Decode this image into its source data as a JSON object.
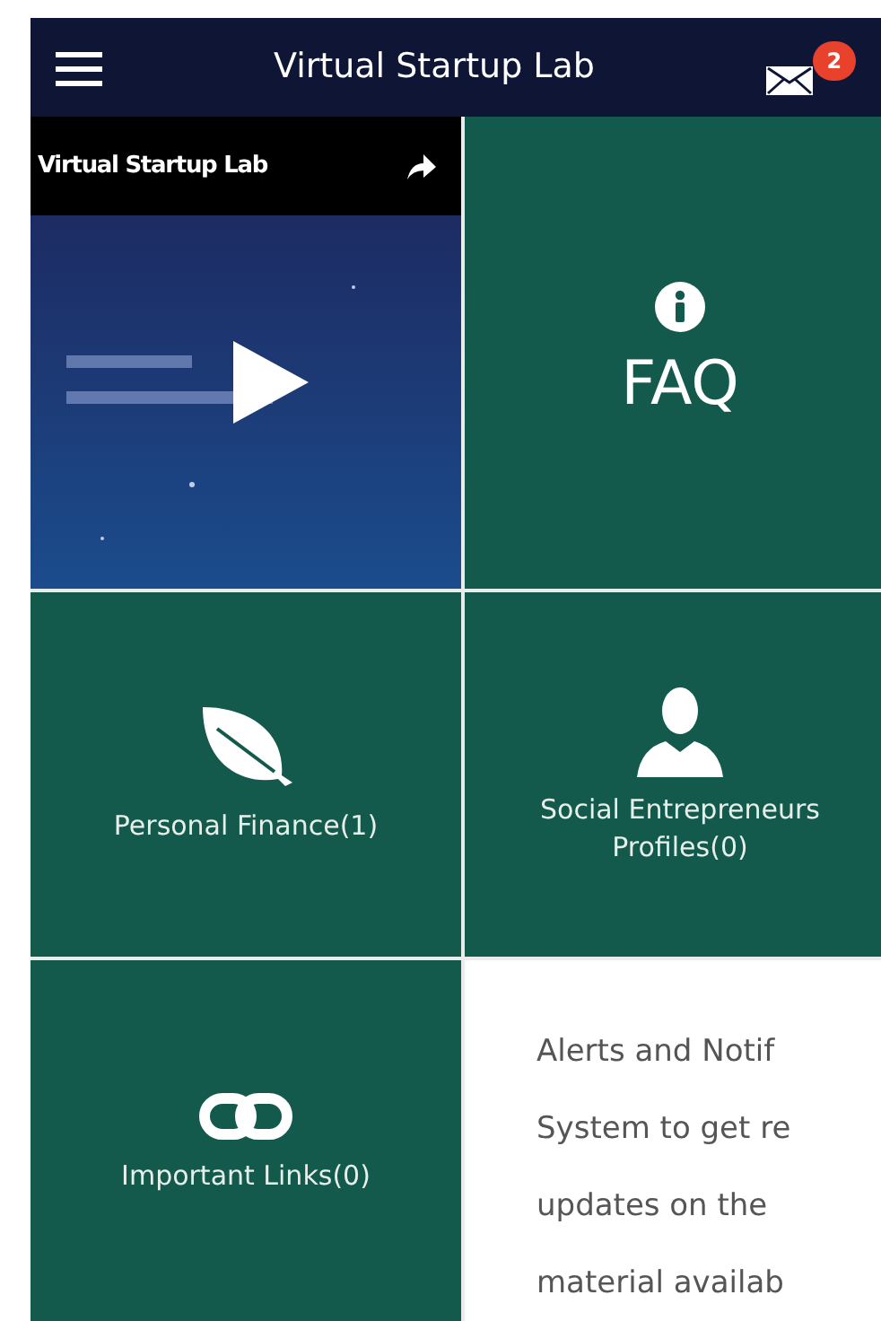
{
  "header": {
    "title": "Virtual Startup Lab",
    "badge": "2"
  },
  "video": {
    "title": "Virtual Startup Lab",
    "kind": "picture"
  },
  "tiles": [
    {
      "kind": "info",
      "label": "FAQ"
    },
    {
      "kind": "leaf",
      "label": "Personal Finance(1)"
    },
    {
      "kind": "person",
      "label": "Social Entrepreneurs Profiles(0)"
    },
    {
      "kind": "link",
      "label": "Important Links(0)"
    }
  ],
  "notice": {
    "lines": [
      "Alerts and Notif",
      "System to get re",
      "updates on the",
      "material availab"
    ]
  }
}
